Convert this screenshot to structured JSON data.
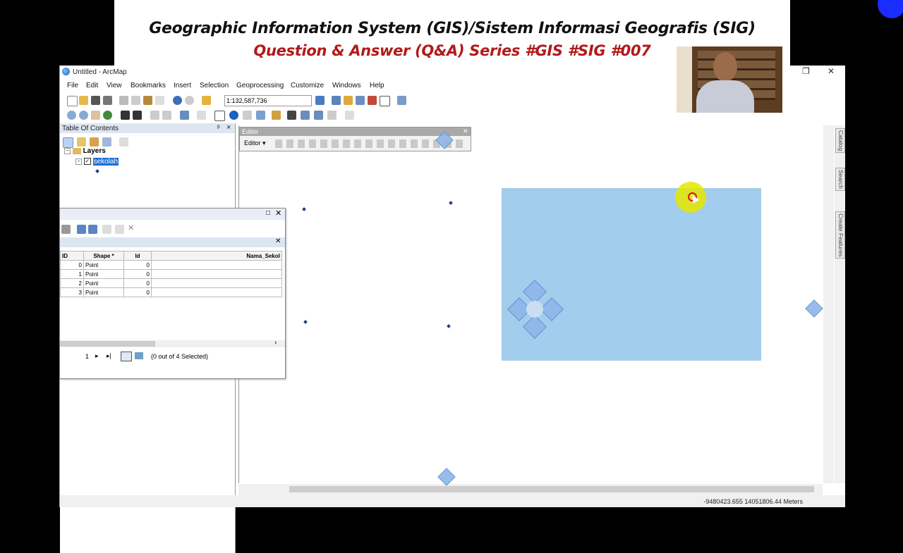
{
  "banner": {
    "line1": "Geographic Information System (GIS)/Sistem Informasi Geografis (SIG)",
    "line2": "Question & Answer (Q&A) Series #GIS #SIG #007"
  },
  "window": {
    "title": "Untitled - ArcMap",
    "restore_icon": "restore-icon",
    "close_icon": "close-icon"
  },
  "menu": [
    "File",
    "Edit",
    "View",
    "Bookmarks",
    "Insert",
    "Selection",
    "Geoprocessing",
    "Customize",
    "Windows",
    "Help"
  ],
  "toolbar": {
    "scale_value": "1:132,587,736"
  },
  "toc": {
    "title": "Table Of Contents",
    "pin": "ᵖ",
    "close": "×",
    "root_label": "Layers",
    "layer_label": "sekolah"
  },
  "editor": {
    "title": "Editor",
    "menu_label": "Editor ▾"
  },
  "attribute_table": {
    "columns": [
      "ID",
      "Shape *",
      "Id",
      "Nama_Sekol"
    ],
    "rows": [
      [
        "0",
        "Point",
        "0",
        ""
      ],
      [
        "1",
        "Point",
        "0",
        ""
      ],
      [
        "2",
        "Point",
        "0",
        ""
      ],
      [
        "3",
        "Point",
        "0",
        ""
      ]
    ],
    "record_nav": "1",
    "selection_status": "(0 out of 4 Selected)"
  },
  "side_tabs": [
    "Catalog",
    "Search",
    "Create Features"
  ],
  "status": {
    "coordinates": "-9480423.655  14051806.44 Meters"
  },
  "colors": {
    "extent_fill": "#a3cdec",
    "banner_red": "#b11a1a",
    "highlight": "#1f6fd1"
  }
}
